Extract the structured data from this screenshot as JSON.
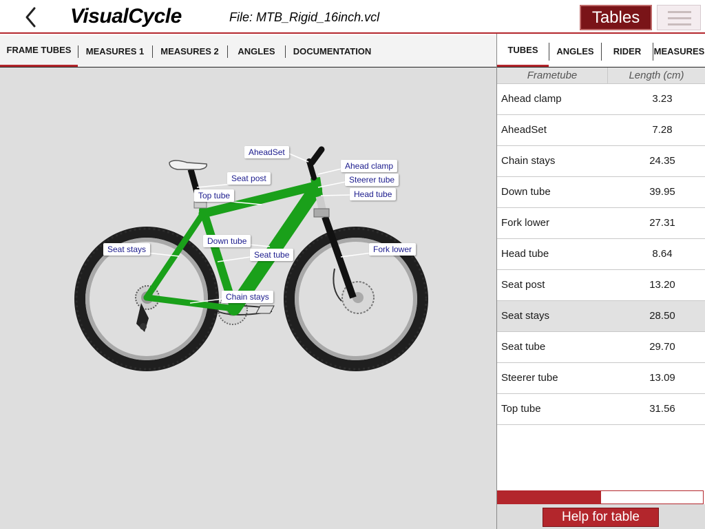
{
  "app": {
    "title": "VisualCycle",
    "file": "File: MTB_Rigid_16inch.vcl"
  },
  "header": {
    "tables_label": "Tables"
  },
  "left_tabs": [
    "FRAME TUBES",
    "MEASURES 1",
    "MEASURES 2",
    "ANGLES",
    "DOCUMENTATION"
  ],
  "right_tabs": [
    "TUBES",
    "ANGLES",
    "RIDER",
    "MEASURES"
  ],
  "labels": {
    "aheadset": "AheadSet",
    "seat_post": "Seat post",
    "top_tube": "Top tube",
    "ahead_clamp": "Ahead clamp",
    "steerer_tube": "Steerer tube",
    "head_tube": "Head tube",
    "seat_stays": "Seat stays",
    "down_tube": "Down tube",
    "seat_tube": "Seat tube",
    "fork_lower": "Fork lower",
    "chain_stays": "Chain stays"
  },
  "table": {
    "headers": [
      "Frametube",
      "Length (cm)"
    ],
    "rows": [
      {
        "name": "Ahead clamp",
        "value": "3.23"
      },
      {
        "name": "AheadSet",
        "value": "7.28"
      },
      {
        "name": "Chain stays",
        "value": "24.35"
      },
      {
        "name": "Down tube",
        "value": "39.95"
      },
      {
        "name": "Fork lower",
        "value": "27.31"
      },
      {
        "name": "Head tube",
        "value": "8.64"
      },
      {
        "name": "Seat post",
        "value": "13.20"
      },
      {
        "name": "Seat stays",
        "value": "28.50"
      },
      {
        "name": "Seat tube",
        "value": "29.70"
      },
      {
        "name": "Steerer tube",
        "value": "13.09"
      },
      {
        "name": "Top tube",
        "value": "31.56"
      }
    ],
    "selected_index": 7
  },
  "help_label": "Help for table",
  "colors": {
    "accent": "#b3262c",
    "frame": "#1aa01a",
    "label_text": "#1a1a8c"
  }
}
